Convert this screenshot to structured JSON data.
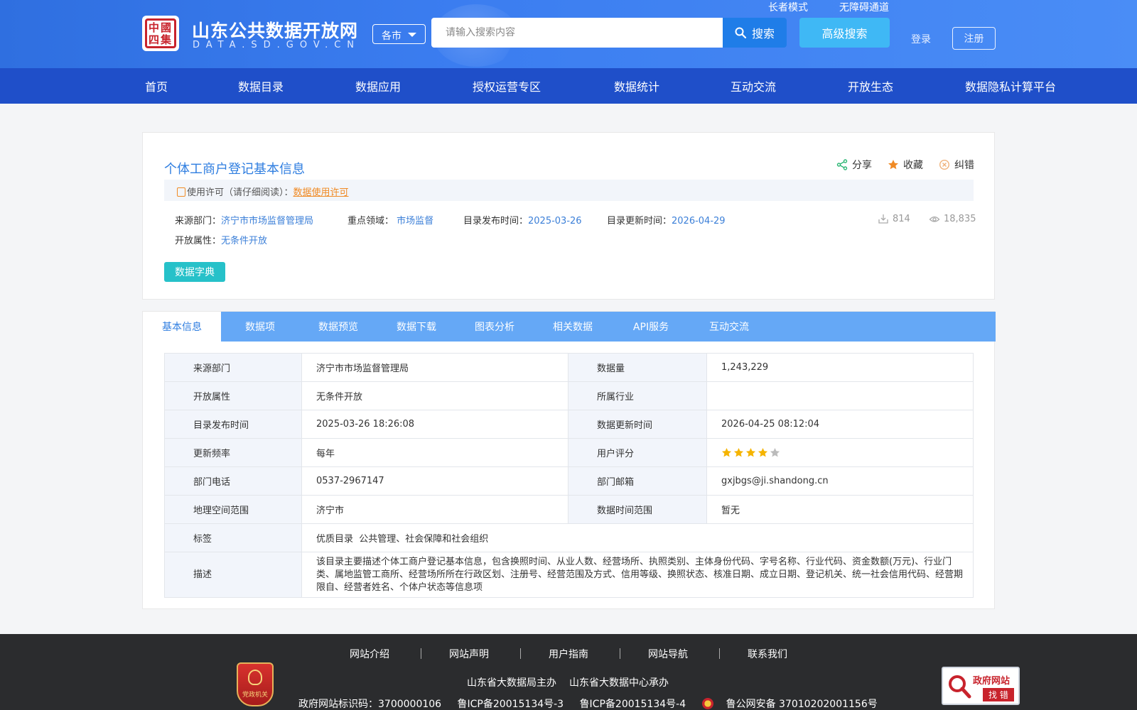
{
  "header": {
    "seal_text": "中國四集",
    "site_title": "山东公共数据开放网",
    "site_domain": "DATA.SD.GOV.CN",
    "city_select": "各市",
    "search_placeholder": "请输入搜索内容",
    "search_button": "搜索",
    "advanced_search": "高级搜索",
    "elder_mode": "长者模式",
    "accessibility": "无障碍通道",
    "login": "登录",
    "register": "注册"
  },
  "nav": {
    "items": [
      "首页",
      "数据目录",
      "数据应用",
      "授权运营专区",
      "数据统计",
      "互动交流",
      "开放生态",
      "数据隐私计算平台"
    ]
  },
  "dataset": {
    "title": "个体工商户登记基本信息",
    "actions": {
      "share": "分享",
      "favorite": "收藏",
      "report": "纠错"
    },
    "license_label": "使用许可（请仔细阅读）：",
    "license_link": "数据使用许可",
    "source_label": "来源部门：",
    "source_value": "济宁市市场监督管理局",
    "domain_label": "重点领域：",
    "domain_value": "市场监督",
    "publish_label": "目录发布时间：",
    "publish_value": "2025-03-26",
    "update_label": "目录更新时间：",
    "update_value": "2026-04-29",
    "open_label": "开放属性：",
    "open_value": "无条件开放",
    "downloads": "814",
    "views": "18,835",
    "dict_button": "数据字典"
  },
  "tabs": [
    "基本信息",
    "数据项",
    "数据预览",
    "数据下载",
    "图表分析",
    "相关数据",
    "API服务",
    "互动交流"
  ],
  "info_table": {
    "source_label": "来源部门",
    "source_value": "济宁市市场监督管理局",
    "volume_label": "数据量",
    "volume_value": "1,243,229",
    "open_label": "开放属性",
    "open_value": "无条件开放",
    "industry_label": "所属行业",
    "industry_value": "",
    "publish_label": "目录发布时间",
    "publish_value": "2025-03-26 18:26:08",
    "update_label": "数据更新时间",
    "update_value": "2026-04-25 08:12:04",
    "freq_label": "更新频率",
    "freq_value": "每年",
    "rating_label": "用户评分",
    "rating_value": 4,
    "rating_max": 5,
    "phone_label": "部门电话",
    "phone_value": "0537-2967147",
    "email_label": "部门邮箱",
    "email_value": "gxjbgs@ji.shandong.cn",
    "geo_label": "地理空间范围",
    "geo_value": "济宁市",
    "time_label": "数据时间范围",
    "time_value": "暂无",
    "tags_label": "标签",
    "tags_value": "优质目录  公共管理、社会保障和社会组织",
    "desc_label": "描述",
    "desc_value": "该目录主要描述个体工商户登记基本信息，包含换照时间、从业人数、经营场所、执照类别、主体身份代码、字号名称、行业代码、资金数额(万元)、行业门类、属地监管工商所、经营场所所在行政区划、注册号、经营范围及方式、信用等级、换照状态、核准日期、成立日期、登记机关、统一社会信用代码、经营期限自、经营者姓名、个体户状态等信息项"
  },
  "footer": {
    "links": [
      "网站介绍",
      "网站声明",
      "用户指南",
      "网站导航",
      "联系我们"
    ],
    "host": "山东省大数据局主办",
    "organizer": "山东省大数据中心承办",
    "site_id": "政府网站标识码：3700000106",
    "icp1": "鲁ICP备20015134号-3",
    "icp2": "鲁ICP备20015134号-4",
    "police": "鲁公网安备 37010202001156号",
    "party_badge": "党政机关",
    "gov_badge_title": "政府网站",
    "gov_badge_action": "找 错"
  },
  "colors": {
    "header_blue": "#3b7df0",
    "nav_blue": "#1f4fc9",
    "link_blue": "#2f7ee0",
    "tab_blue": "#65a8f6",
    "teal": "#26c1c9",
    "orange": "#f08a24",
    "star_gold": "#f5b400"
  }
}
